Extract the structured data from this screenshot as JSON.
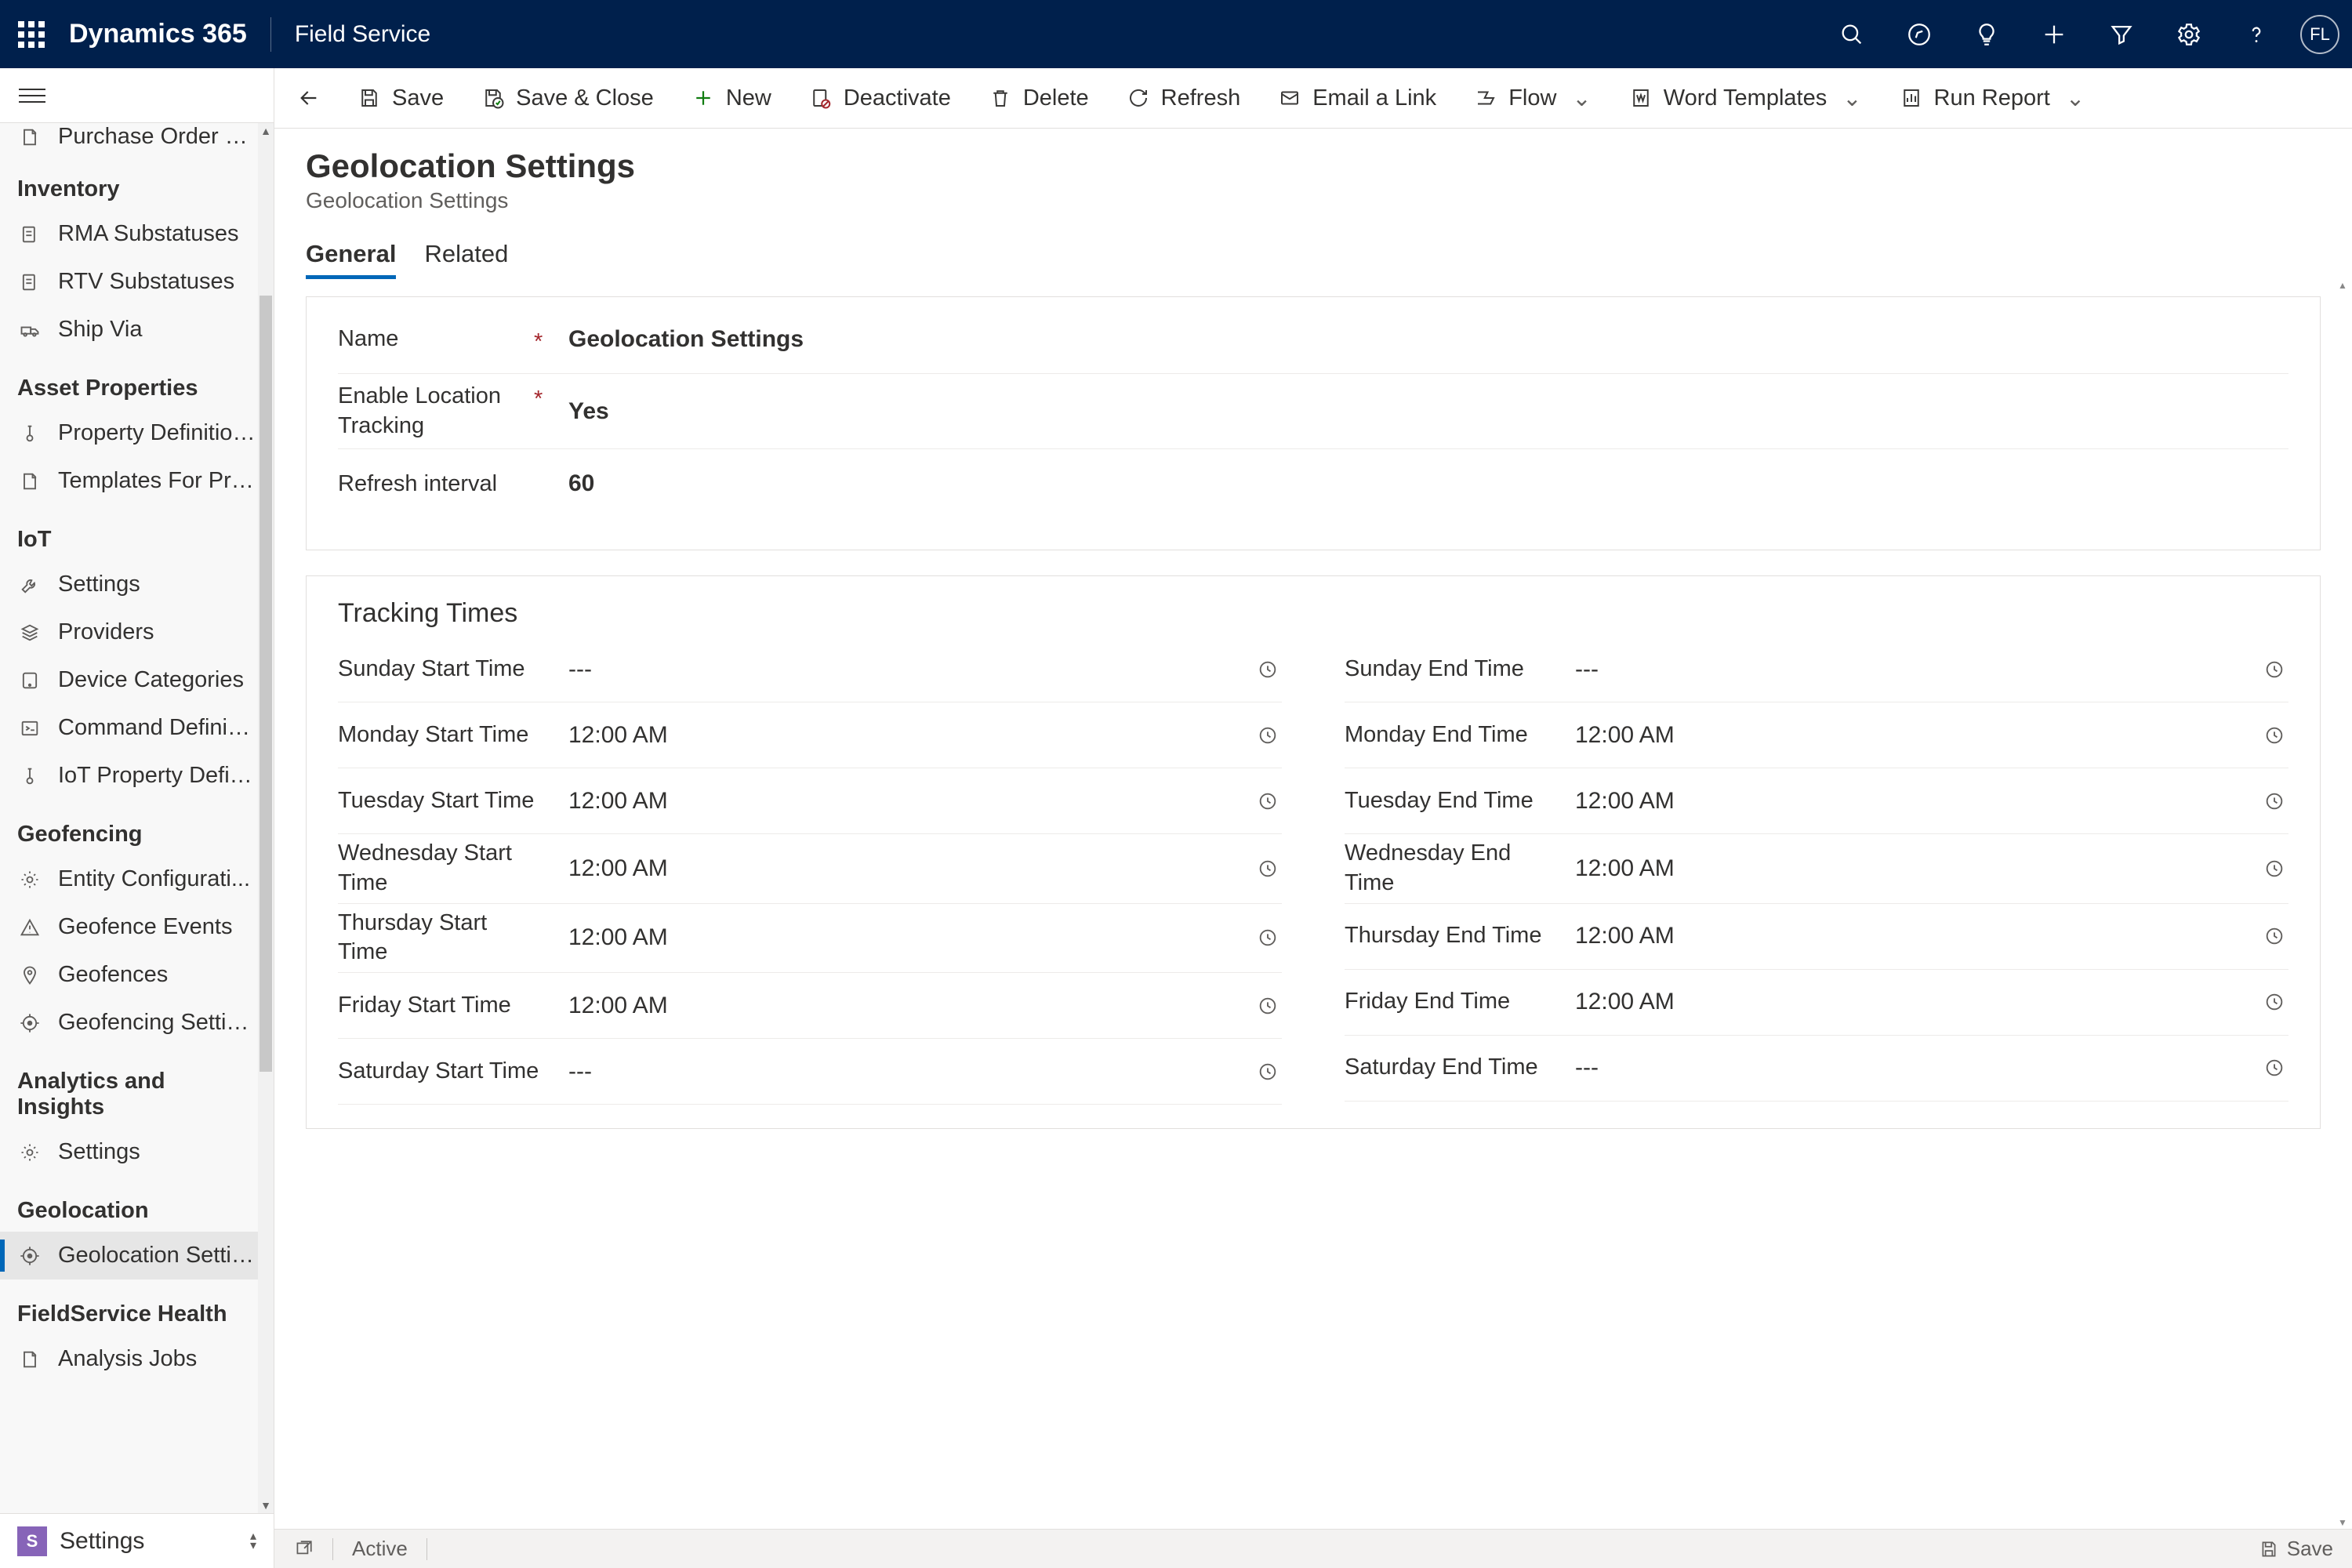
{
  "topbar": {
    "brand": "Dynamics 365",
    "app": "Field Service",
    "avatar": "FL"
  },
  "sidebar": {
    "cut_item": "Purchase Order Su...",
    "groups": [
      {
        "header": "Inventory",
        "items": [
          {
            "label": "RMA Substatuses",
            "icon": "doc"
          },
          {
            "label": "RTV Substatuses",
            "icon": "doc"
          },
          {
            "label": "Ship Via",
            "icon": "truck"
          }
        ]
      },
      {
        "header": "Asset Properties",
        "items": [
          {
            "label": "Property Definitions",
            "icon": "therm"
          },
          {
            "label": "Templates For Pro...",
            "icon": "page"
          }
        ]
      },
      {
        "header": "IoT",
        "items": [
          {
            "label": "Settings",
            "icon": "wrench"
          },
          {
            "label": "Providers",
            "icon": "stack"
          },
          {
            "label": "Device Categories",
            "icon": "device"
          },
          {
            "label": "Command Definiti...",
            "icon": "cmd"
          },
          {
            "label": "IoT Property Defin...",
            "icon": "therm"
          }
        ]
      },
      {
        "header": "Geofencing",
        "items": [
          {
            "label": "Entity Configurati...",
            "icon": "gear"
          },
          {
            "label": "Geofence Events",
            "icon": "warn"
          },
          {
            "label": "Geofences",
            "icon": "pin"
          },
          {
            "label": "Geofencing Settings",
            "icon": "target"
          }
        ]
      },
      {
        "header": "Analytics and Insights",
        "items": [
          {
            "label": "Settings",
            "icon": "gear"
          }
        ]
      },
      {
        "header": "Geolocation",
        "items": [
          {
            "label": "Geolocation Settin...",
            "icon": "target",
            "selected": true
          }
        ]
      },
      {
        "header": "FieldService Health",
        "items": [
          {
            "label": "Analysis Jobs",
            "icon": "page"
          }
        ]
      }
    ],
    "area": {
      "badge": "S",
      "label": "Settings"
    }
  },
  "commands": {
    "save": "Save",
    "save_close": "Save & Close",
    "new": "New",
    "deactivate": "Deactivate",
    "delete": "Delete",
    "refresh": "Refresh",
    "email": "Email a Link",
    "flow": "Flow",
    "word": "Word Templates",
    "report": "Run Report"
  },
  "page": {
    "title": "Geolocation Settings",
    "subtitle": "Geolocation Settings",
    "tabs": {
      "general": "General",
      "related": "Related"
    }
  },
  "form": {
    "name": {
      "label": "Name",
      "value": "Geolocation Settings",
      "required": true
    },
    "enable": {
      "label": "Enable Location Tracking",
      "value": "Yes",
      "required": true
    },
    "refresh": {
      "label": "Refresh interval",
      "value": "60"
    },
    "section_title": "Tracking Times",
    "start": [
      {
        "label": "Sunday Start Time",
        "value": "---"
      },
      {
        "label": "Monday Start Time",
        "value": "12:00 AM"
      },
      {
        "label": "Tuesday Start Time",
        "value": "12:00 AM"
      },
      {
        "label": "Wednesday Start Time",
        "value": "12:00 AM"
      },
      {
        "label": "Thursday Start Time",
        "value": "12:00 AM"
      },
      {
        "label": "Friday Start Time",
        "value": "12:00 AM"
      },
      {
        "label": "Saturday Start Time",
        "value": "---"
      }
    ],
    "end": [
      {
        "label": "Sunday End Time",
        "value": "---"
      },
      {
        "label": "Monday End Time",
        "value": "12:00 AM"
      },
      {
        "label": "Tuesday End Time",
        "value": "12:00 AM"
      },
      {
        "label": "Wednesday End Time",
        "value": "12:00 AM"
      },
      {
        "label": "Thursday End Time",
        "value": "12:00 AM"
      },
      {
        "label": "Friday End Time",
        "value": "12:00 AM"
      },
      {
        "label": "Saturday End Time",
        "value": "---"
      }
    ]
  },
  "status": {
    "state": "Active",
    "save": "Save"
  }
}
